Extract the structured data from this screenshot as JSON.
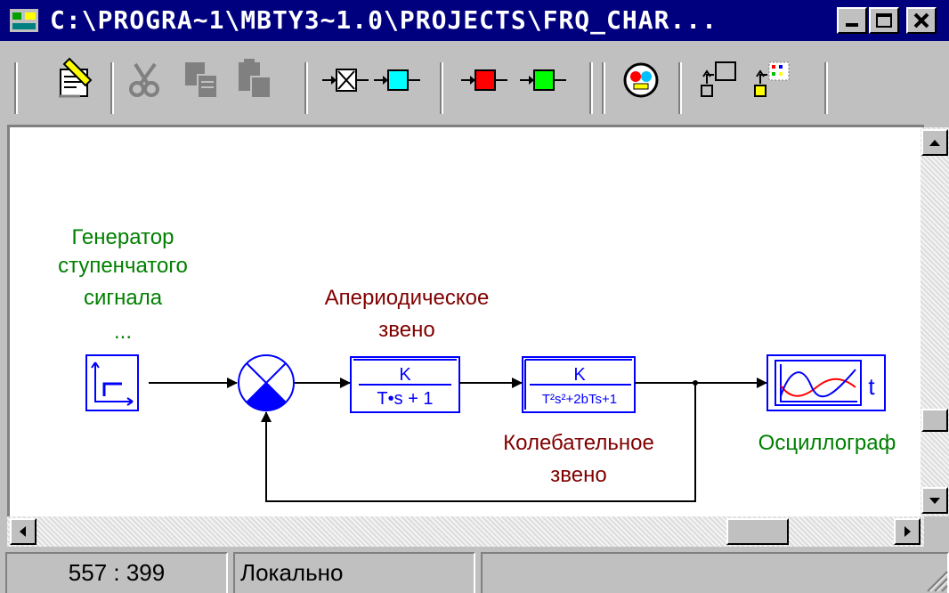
{
  "window": {
    "title": "C:\\PROGRA~1\\MBTY3~1.0\\PROJECTS\\FRQ_CHAR..."
  },
  "toolbar": {
    "tools": [
      {
        "icon": "edit-properties-icon",
        "enabled": true
      },
      {
        "icon": "cut-icon",
        "enabled": false
      },
      {
        "icon": "copy-icon",
        "enabled": false
      },
      {
        "icon": "paste-icon",
        "enabled": false
      },
      {
        "icon": "add-input-block-icon",
        "enabled": true
      },
      {
        "icon": "add-cyan-block-icon",
        "enabled": true
      },
      {
        "icon": "add-red-block-icon",
        "enabled": true
      },
      {
        "icon": "add-green-block-icon",
        "enabled": true
      },
      {
        "icon": "simulation-run-icon",
        "enabled": true
      },
      {
        "icon": "new-window-icon",
        "enabled": true
      },
      {
        "icon": "new-colored-window-icon",
        "enabled": true
      }
    ]
  },
  "diagram": {
    "generator_label": [
      "Генератор",
      "ступенчатого",
      "сигнала",
      "..."
    ],
    "aperiodic_label": [
      "Апериодическое",
      "звено"
    ],
    "aperiodic_tf": {
      "num": "K",
      "den": "T•s + 1"
    },
    "oscillatory_tf": {
      "num": "K",
      "den": "T²s²+2bTs+1"
    },
    "oscillatory_label": [
      "Колебательное",
      "звено"
    ],
    "oscilloscope_label": "Осциллограф",
    "oscilloscope_axis": "t",
    "colors": {
      "green": "#008000",
      "darkred": "#800000",
      "blue": "#0000ff",
      "wire": "#000000"
    }
  },
  "status": {
    "coords": "557 : 399",
    "mode": "Локально"
  }
}
